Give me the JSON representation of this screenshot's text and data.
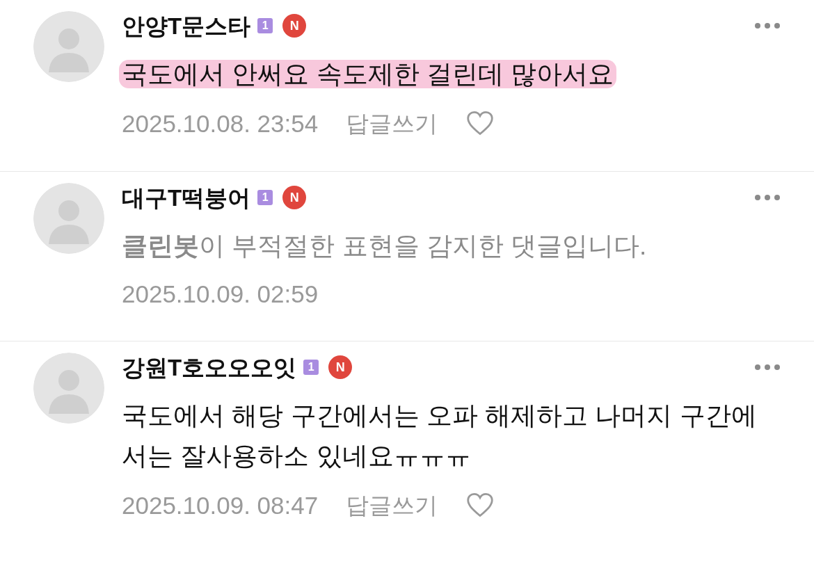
{
  "comments": [
    {
      "author": "안양T문스타",
      "level_badge": "1",
      "new_badge": "N",
      "kind": "normal",
      "highlighted": true,
      "text": "국도에서 안써요 속도제한 걸린데 많아서요",
      "date": "2025.10.08. 23:54",
      "reply": "답글쓰기"
    },
    {
      "author": "대구T떡붕어",
      "level_badge": "1",
      "new_badge": "N",
      "kind": "cleanbot",
      "highlighted": false,
      "text": "**클린봇**이 부적절한 표현을 감지한 댓글입니다.",
      "date": "2025.10.09. 02:59"
    },
    {
      "author": "강원T호오오오잇",
      "level_badge": "1",
      "new_badge": "N",
      "kind": "normal",
      "highlighted": false,
      "text": "국도에서 해당 구간에서는 오파 해제하고 나머지 구간에서는 잘사용하소 있네요ㅠㅠㅠ",
      "date": "2025.10.09. 08:47",
      "reply": "답글쓰기"
    }
  ]
}
